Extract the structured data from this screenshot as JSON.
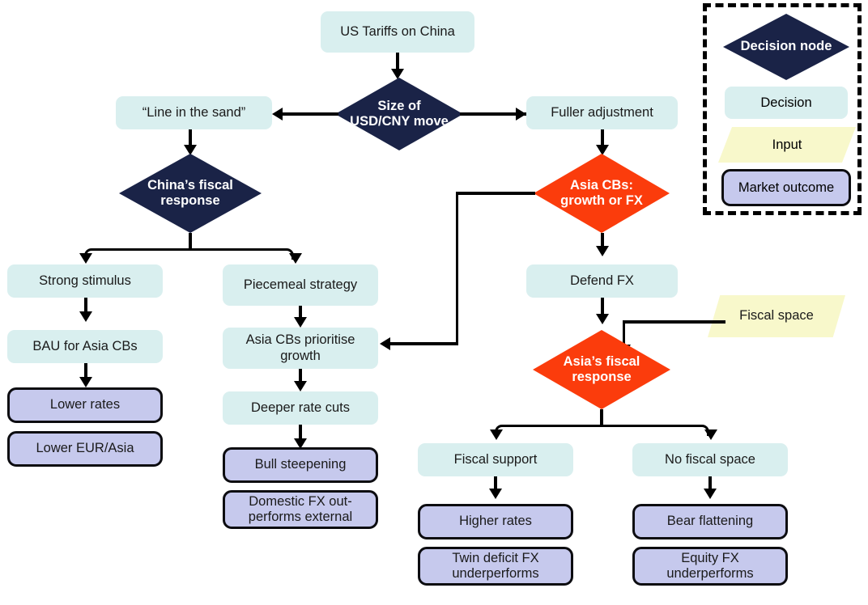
{
  "diagram": {
    "title_node": "US Tariffs on China",
    "type": "flowchart",
    "legend": {
      "name": "Legend",
      "items": [
        {
          "label": "Decision node",
          "shape": "diamond",
          "color": "#1a2347"
        },
        {
          "label": "Decision",
          "shape": "rounded-rect",
          "color": "#d9efef"
        },
        {
          "label": "Input",
          "shape": "parallelogram",
          "color": "#f8f8cb"
        },
        {
          "label": "Market outcome",
          "shape": "rounded-rect-bordered",
          "color": "#c6c9ed"
        }
      ]
    },
    "nodes": {
      "us_tariffs": "US Tariffs on China",
      "size_usdcny": "Size of USD/CNY move",
      "line_in_sand": "“Line in the sand”",
      "fuller_adjustment": "Fuller adjustment",
      "chinas_fiscal_response": "China’s fiscal response",
      "asia_cbs_growth_or_fx": "Asia CBs: growth or FX",
      "strong_stimulus": "Strong stimulus",
      "piecemeal_strategy": "Piecemeal strategy",
      "defend_fx": "Defend FX",
      "fiscal_space": "Fiscal space",
      "bau_for_asia_cbs": "BAU for Asia CBs",
      "asia_cbs_prioritise_growth": "Asia CBs prioritise growth",
      "asias_fiscal_response": "Asia’s fiscal response",
      "lower_rates": "Lower rates",
      "lower_eur_asia": "Lower EUR/Asia",
      "deeper_rate_cuts": "Deeper rate cuts",
      "bull_steepening": "Bull steepening",
      "domestic_fx": "Domestic FX out-performs external",
      "fiscal_support": "Fiscal support",
      "no_fiscal_space": "No fiscal space",
      "higher_rates": "Higher rates",
      "twin_deficit_fx": "Twin deficit FX underperforms",
      "bear_flattening": "Bear flattening",
      "equity_fx": "Equity FX underperforms"
    },
    "colors": {
      "decision_node_navy": "#1a2347",
      "decision_node_red": "#fb3c0c",
      "decision_box": "#d9efef",
      "input_box": "#f8f8cb",
      "outcome_box": "#c6c9ed",
      "connector": "#000000"
    }
  }
}
